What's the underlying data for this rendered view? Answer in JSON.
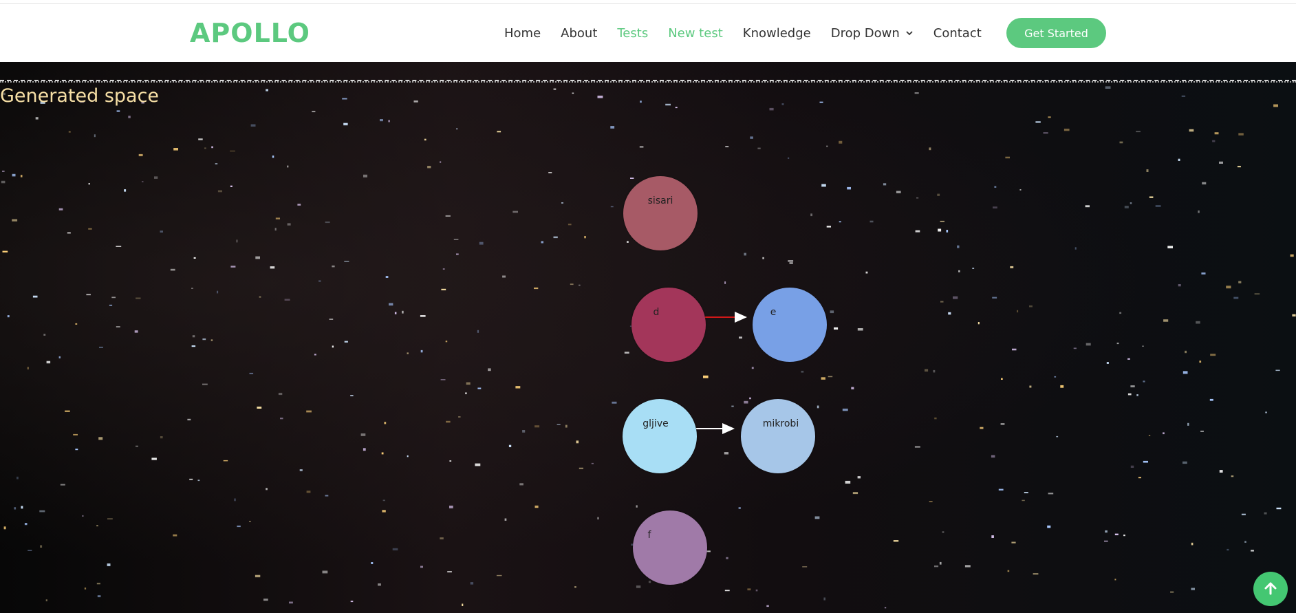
{
  "brand": {
    "logo": "APOLLO"
  },
  "nav": {
    "items": [
      {
        "label": "Home",
        "active": false
      },
      {
        "label": "About",
        "active": false
      },
      {
        "label": "Tests",
        "active": true
      },
      {
        "label": "New test",
        "active": true
      },
      {
        "label": "Knowledge",
        "active": false
      },
      {
        "label": "Drop Down",
        "active": false
      },
      {
        "label": "Contact",
        "active": false
      }
    ],
    "cta_label": "Get Started"
  },
  "space": {
    "title": "Generated space",
    "nodes": [
      {
        "label": "sisari",
        "color": "#a75a66"
      },
      {
        "label": "d",
        "color": "#a3365a"
      },
      {
        "label": "e",
        "color": "#78a0e6"
      },
      {
        "label": "gljive",
        "color": "#a8def5"
      },
      {
        "label": "mikrobi",
        "color": "#a6c6e8"
      },
      {
        "label": "f",
        "color": "#a07aa8"
      }
    ],
    "links": [
      {
        "from": "d",
        "to": "e",
        "color": "#d01818"
      },
      {
        "from": "gljive",
        "to": "mikrobi",
        "color": "#ffffff"
      }
    ]
  },
  "colors": {
    "accent": "#5cc97f",
    "title": "#f6dfa5"
  },
  "icons": {
    "dropdown": "chevron-down-icon",
    "back_to_top": "arrow-up-icon"
  }
}
